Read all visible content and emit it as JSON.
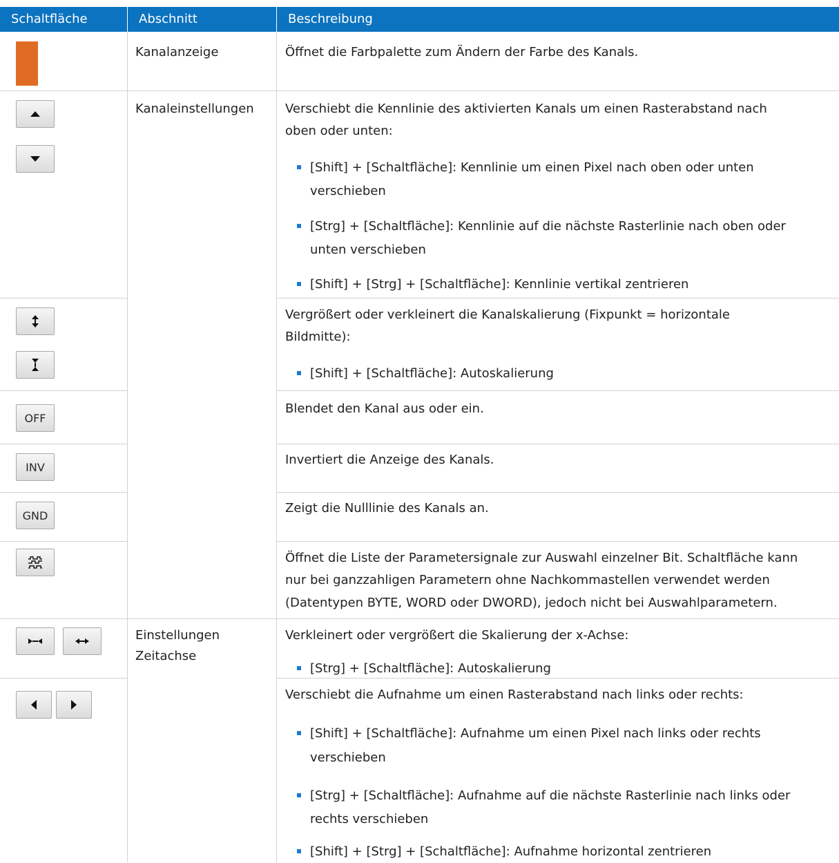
{
  "table": {
    "headers": {
      "button": "Schaltfläche",
      "section": "Abschnitt",
      "description": "Beschreibung"
    },
    "rows": [
      {
        "section": "Kanalanzeige",
        "description": [
          "Öffnet die Farbpalette zum Ändern der Farbe des Kanals."
        ]
      },
      {
        "section": "Kanaleinstellungen",
        "description": [
          "Verschiebt die Kennlinie des aktivierten Kanals um einen Rasterabstand nach",
          "oben oder unten:"
        ],
        "bullets": [
          [
            "[Shift] + [Schaltfläche]: Kennlinie um einen Pixel nach oben oder unten",
            "verschieben"
          ],
          [
            "[Strg] + [Schaltfläche]: Kennlinie auf die nächste Rasterlinie nach oben oder",
            "unten verschieben"
          ],
          [
            "[Shift] + [Strg] + [Schaltfläche]: Kennlinie vertikal zentrieren"
          ]
        ]
      },
      {
        "description": [
          "Vergrößert oder verkleinert die Kanalskalierung (Fixpunkt = horizontale",
          "Bildmitte):"
        ],
        "bullets": [
          [
            "[Shift] + [Schaltfläche]: Autoskalierung"
          ]
        ]
      },
      {
        "button_label": "OFF",
        "description": [
          "Blendet den Kanal aus oder ein."
        ]
      },
      {
        "button_label": "INV",
        "description": [
          "Invertiert die Anzeige des Kanals."
        ]
      },
      {
        "button_label": "GND",
        "description": [
          "Zeigt die Nulllinie des Kanals an."
        ]
      },
      {
        "description": [
          "Öffnet die Liste der Parametersignale zur Auswahl einzelner Bit. Schaltfläche kann",
          "nur bei ganzzahligen Parametern ohne Nachkommastellen verwendet werden",
          "(Datentypen BYTE, WORD oder DWORD), jedoch nicht bei Auswahlparametern."
        ]
      },
      {
        "section": [
          "Einstellungen",
          "Zeitachse"
        ],
        "description": [
          "Verkleinert oder vergrößert die Skalierung der x-Achse:"
        ],
        "bullets": [
          [
            "[Strg] + [Schaltfläche]: Autoskalierung"
          ]
        ]
      },
      {
        "description": [
          "Verschiebt die Aufnahme um einen Rasterabstand nach links oder rechts:"
        ],
        "bullets": [
          [
            "[Shift] + [Schaltfläche]: Aufnahme um einen Pixel nach links oder rechts",
            "verschieben"
          ],
          [
            "[Strg] + [Schaltfläche]: Aufnahme auf die nächste Rasterlinie nach links oder",
            "rechts verschieben"
          ],
          [
            "[Shift] + [Strg] + [Schaltfläche]: Aufnahme horizontal zentrieren"
          ]
        ]
      }
    ]
  },
  "colors": {
    "header_bg": "#0b73c0",
    "channel_color": "#e06c24",
    "bullet": "#1e7ad0"
  },
  "icons": [
    "up-arrow-icon",
    "down-arrow-icon",
    "expand-vertical-icon",
    "shrink-vertical-icon",
    "bit-signal-icon",
    "shrink-horizontal-icon",
    "expand-horizontal-icon",
    "left-arrow-icon",
    "right-arrow-icon"
  ]
}
